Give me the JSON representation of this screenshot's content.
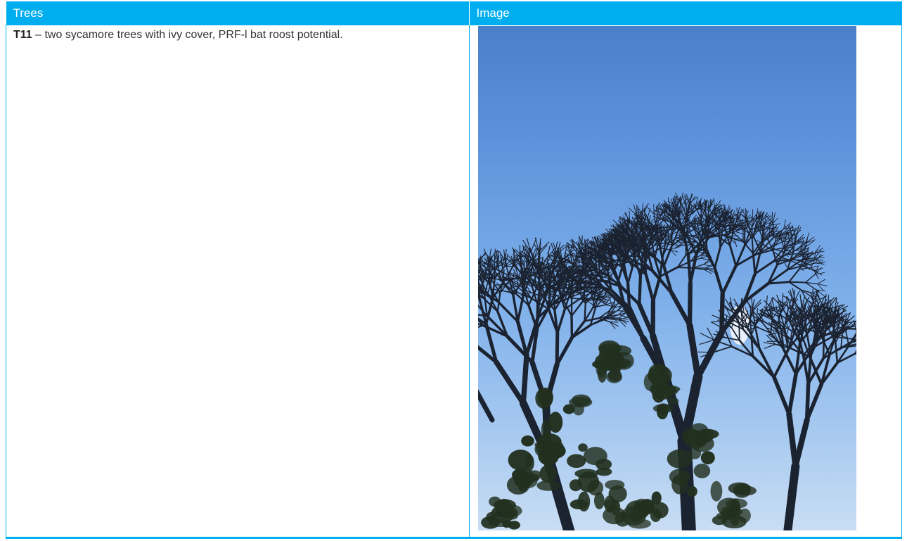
{
  "table": {
    "headers": {
      "col1": "Trees",
      "col2": "Image"
    },
    "rows": [
      {
        "id": "T11",
        "description": " – two sycamore trees with ivy cover, PRF-l bat roost potential."
      }
    ]
  },
  "colors": {
    "accent": "#00aeef",
    "sky_top": "#4a7fc9",
    "sky_bottom": "#c9ddf4",
    "tree": "#1b2230",
    "ivy": "#22301f"
  },
  "photo": {
    "subject": "sycamore-trees-photo"
  }
}
